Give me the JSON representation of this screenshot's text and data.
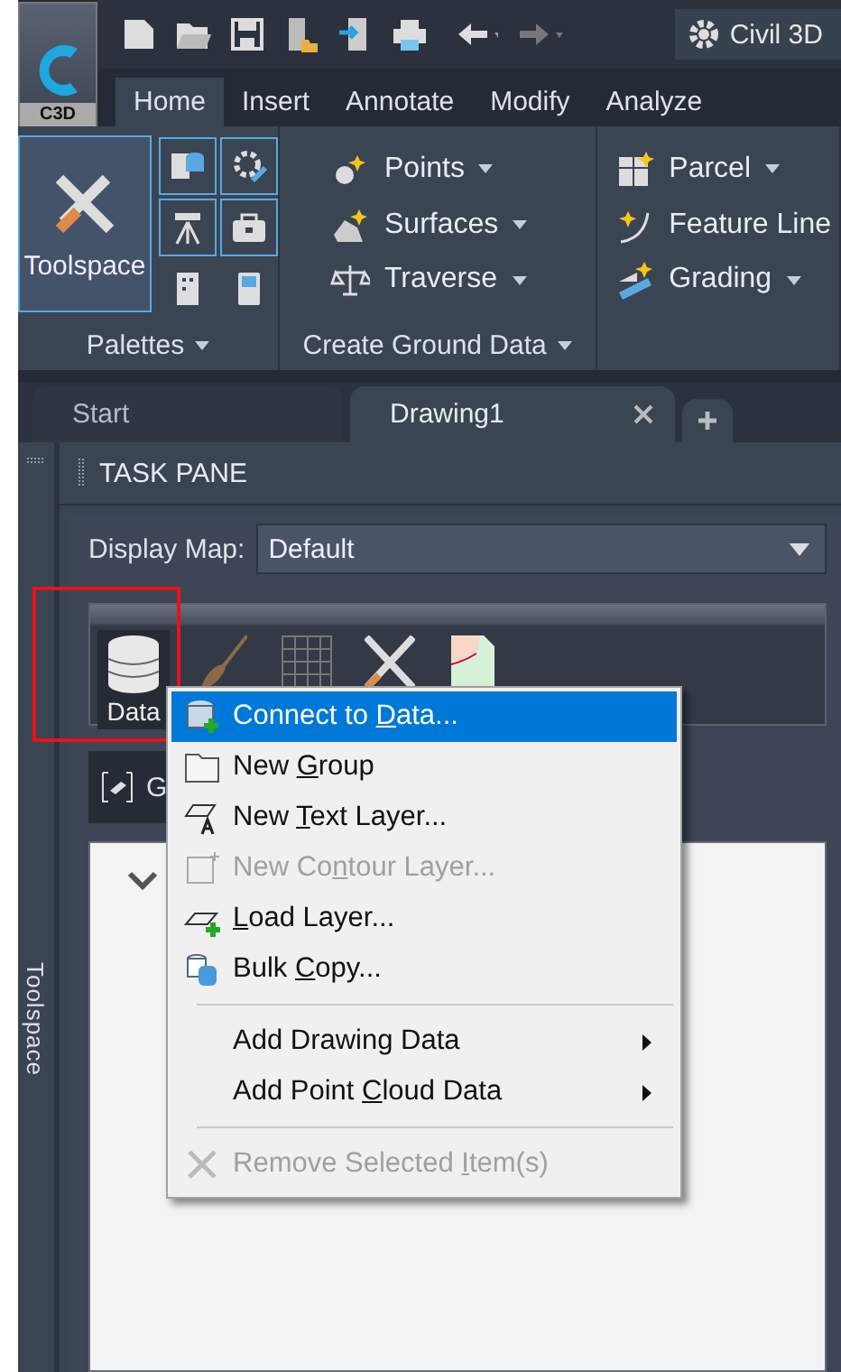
{
  "app_logo": {
    "label": "C3D"
  },
  "workspace": {
    "label": "Civil 3D"
  },
  "ribbon_tabs": [
    {
      "label": "Home",
      "selected": true
    },
    {
      "label": "Insert",
      "selected": false
    },
    {
      "label": "Annotate",
      "selected": false
    },
    {
      "label": "Modify",
      "selected": false
    },
    {
      "label": "Analyze",
      "selected": false
    }
  ],
  "palettes_panel": {
    "title": "Palettes",
    "toolspace": {
      "label": "Toolspace",
      "on": true
    },
    "small_buttons": [
      {
        "on": true
      },
      {
        "on": true
      },
      {
        "on": true
      },
      {
        "on": true
      },
      {
        "on": false
      },
      {
        "on": false
      }
    ]
  },
  "ground_panel": {
    "title": "Create Ground Data",
    "items": [
      {
        "label": "Points"
      },
      {
        "label": "Surfaces"
      },
      {
        "label": "Traverse"
      }
    ]
  },
  "design_panel": {
    "items": [
      {
        "label": "Parcel",
        "dropdown": true
      },
      {
        "label": "Feature Line",
        "dropdown": false
      },
      {
        "label": "Grading",
        "dropdown": true
      }
    ]
  },
  "document_tabs": [
    {
      "label": "Start",
      "selected": false,
      "closable": false
    },
    {
      "label": "Drawing1",
      "selected": true,
      "closable": true
    }
  ],
  "side_strip": {
    "label": "Toolspace"
  },
  "task_pane": {
    "title": "TASK PANE",
    "display_map": {
      "label": "Display Map:",
      "value": "Default"
    },
    "toolbar": [
      {
        "label": "Data",
        "selected": true
      },
      {
        "selected": false
      },
      {
        "selected": false
      },
      {
        "selected": false
      },
      {
        "selected": false
      }
    ],
    "group_bar": {
      "label": "G"
    }
  },
  "context_menu": [
    {
      "kind": "item",
      "parts": [
        {
          "text": "Connect to ",
          "underline": false
        },
        {
          "text": "D",
          "underline": true
        },
        {
          "text": "ata...",
          "underline": false
        }
      ],
      "selected": true,
      "disabled": false,
      "submenu": false
    },
    {
      "kind": "item",
      "parts": [
        {
          "text": "New ",
          "underline": false
        },
        {
          "text": "G",
          "underline": true
        },
        {
          "text": "roup",
          "underline": false
        }
      ],
      "selected": false,
      "disabled": false,
      "submenu": false
    },
    {
      "kind": "item",
      "parts": [
        {
          "text": "New ",
          "underline": false
        },
        {
          "text": "T",
          "underline": true
        },
        {
          "text": "ext Layer...",
          "underline": false
        }
      ],
      "selected": false,
      "disabled": false,
      "submenu": false
    },
    {
      "kind": "item",
      "parts": [
        {
          "text": "New Co",
          "underline": false
        },
        {
          "text": "n",
          "underline": true
        },
        {
          "text": "tour Layer...",
          "underline": false
        }
      ],
      "selected": false,
      "disabled": true,
      "submenu": false
    },
    {
      "kind": "item",
      "parts": [
        {
          "text": "L",
          "underline": true
        },
        {
          "text": "oad Layer...",
          "underline": false
        }
      ],
      "selected": false,
      "disabled": false,
      "submenu": false
    },
    {
      "kind": "item",
      "parts": [
        {
          "text": "Bulk ",
          "underline": false
        },
        {
          "text": "C",
          "underline": true
        },
        {
          "text": "opy...",
          "underline": false
        }
      ],
      "selected": false,
      "disabled": false,
      "submenu": false
    },
    {
      "kind": "separator"
    },
    {
      "kind": "item",
      "parts": [
        {
          "text": "Add Drawing Data",
          "underline": false
        }
      ],
      "selected": false,
      "disabled": false,
      "submenu": true
    },
    {
      "kind": "item",
      "parts": [
        {
          "text": "Add Point ",
          "underline": false
        },
        {
          "text": "C",
          "underline": true
        },
        {
          "text": "loud Data",
          "underline": false
        }
      ],
      "selected": false,
      "disabled": false,
      "submenu": true
    },
    {
      "kind": "separator"
    },
    {
      "kind": "item",
      "parts": [
        {
          "text": "Remove Selected ",
          "underline": false
        },
        {
          "text": "I",
          "underline": true
        },
        {
          "text": "tem(s)",
          "underline": false
        }
      ],
      "selected": false,
      "disabled": true,
      "submenu": false
    }
  ]
}
